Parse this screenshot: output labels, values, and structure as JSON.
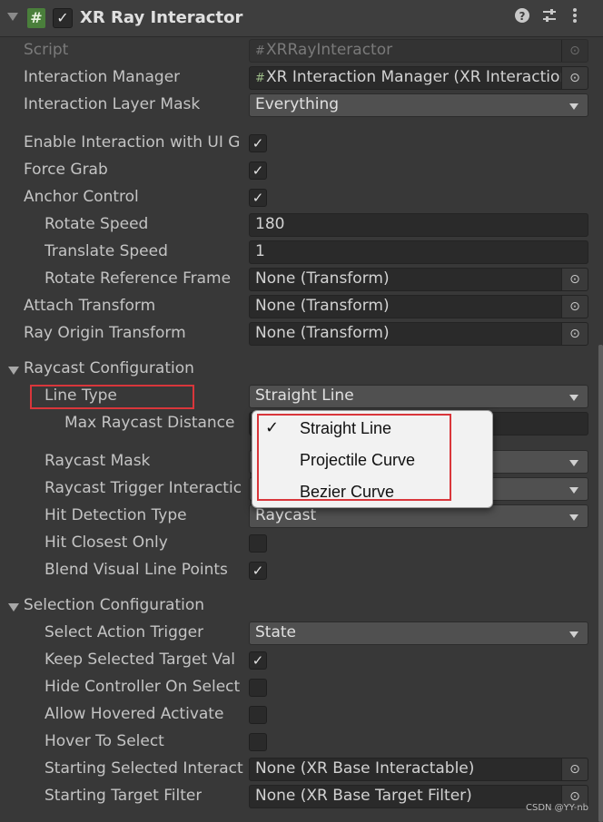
{
  "header": {
    "title": "XR Ray Interactor",
    "enabled": true,
    "script_icon": "#",
    "icons": [
      "help-icon",
      "presets-icon",
      "more-options-icon"
    ]
  },
  "fields": {
    "script": {
      "label": "Script",
      "value": "XRRayInteractor"
    },
    "interaction_manager": {
      "label": "Interaction Manager",
      "value": "XR Interaction Manager (XR Interaction"
    },
    "interaction_layer_mask": {
      "label": "Interaction Layer Mask",
      "value": "Everything"
    },
    "enable_ui": {
      "label": "Enable Interaction with UI G",
      "checked": true
    },
    "force_grab": {
      "label": "Force Grab",
      "checked": true
    },
    "anchor_control": {
      "label": "Anchor Control",
      "checked": true
    },
    "rotate_speed": {
      "label": "Rotate Speed",
      "value": "180"
    },
    "translate_speed": {
      "label": "Translate Speed",
      "value": "1"
    },
    "rotate_reference_frame": {
      "label": "Rotate Reference Frame",
      "value": "None (Transform)"
    },
    "attach_transform": {
      "label": "Attach Transform",
      "value": "None (Transform)"
    },
    "ray_origin_transform": {
      "label": "Ray Origin Transform",
      "value": "None (Transform)"
    }
  },
  "raycast": {
    "section_label": "Raycast Configuration",
    "line_type": {
      "label": "Line Type",
      "value": "Straight Line"
    },
    "max_distance": {
      "label": "Max Raycast Distance"
    },
    "raycast_mask": {
      "label": "Raycast Mask"
    },
    "trigger_interaction": {
      "label": "Raycast Trigger Interactic"
    },
    "hit_detection_type": {
      "label": "Hit Detection Type",
      "value": "Raycast"
    },
    "hit_closest_only": {
      "label": "Hit Closest Only",
      "checked": false
    },
    "blend_visual_line_points": {
      "label": "Blend Visual Line Points",
      "checked": true
    }
  },
  "line_type_menu": {
    "options": [
      {
        "label": "Straight Line",
        "selected": true
      },
      {
        "label": "Projectile Curve",
        "selected": false
      },
      {
        "label": "Bezier Curve",
        "selected": false
      }
    ],
    "check_mark": "✓"
  },
  "selection": {
    "section_label": "Selection Configuration",
    "select_action_trigger": {
      "label": "Select Action Trigger",
      "value": "State"
    },
    "keep_selected": {
      "label": "Keep Selected Target Val",
      "checked": true
    },
    "hide_controller": {
      "label": "Hide Controller On Select",
      "checked": false
    },
    "allow_hovered_activate": {
      "label": "Allow Hovered Activate",
      "checked": false
    },
    "hover_to_select": {
      "label": "Hover To Select",
      "checked": false
    },
    "starting_selected": {
      "label": "Starting Selected Interact",
      "value": "None (XR Base Interactable)"
    },
    "starting_target_filter": {
      "label": "Starting Target Filter",
      "value": "None (XR Base Target Filter)"
    }
  },
  "watermark": "CSDN @YY-nb",
  "colors": {
    "highlight": "#d9363b",
    "panel": "#383838",
    "field": "#2a2a2a",
    "dropdown": "#505050"
  }
}
